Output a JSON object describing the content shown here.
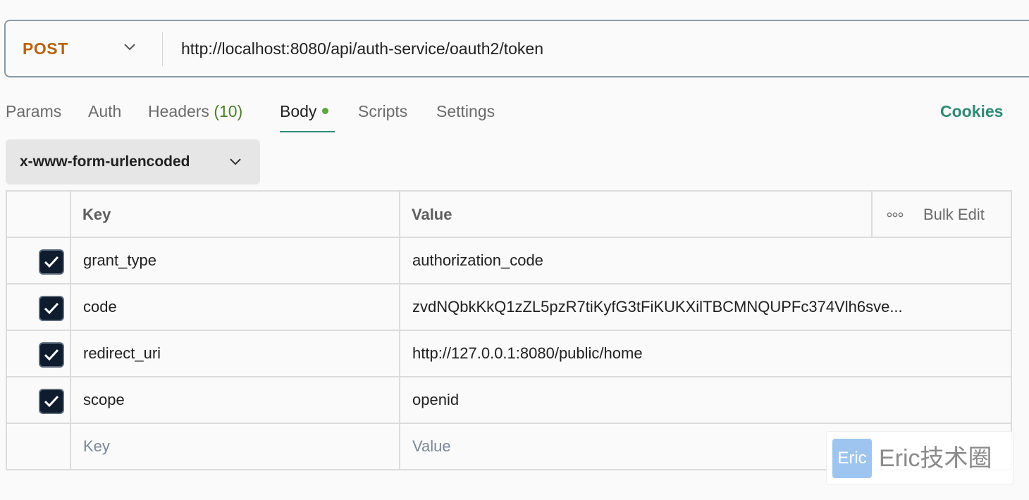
{
  "request": {
    "method": "POST",
    "url": "http://localhost:8080/api/auth-service/oauth2/token"
  },
  "tabs": {
    "params": "Params",
    "auth": "Auth",
    "headers": "Headers",
    "headers_count": "(10)",
    "body": "Body",
    "scripts": "Scripts",
    "settings": "Settings",
    "active": "Body"
  },
  "cookies_label": "Cookies",
  "body_type": "x-www-form-urlencoded",
  "table": {
    "key_header": "Key",
    "value_header": "Value",
    "bulk_edit": "Bulk Edit",
    "rows": [
      {
        "checked": true,
        "key": "grant_type",
        "value": "authorization_code"
      },
      {
        "checked": true,
        "key": "code",
        "value": "zvdNQbkKkQ1zZL5pzR7tiKyfG3tFiKUKXilTBCMNQUPFc374Vlh6sve..."
      },
      {
        "checked": true,
        "key": "redirect_uri",
        "value": "http://127.0.0.1:8080/public/home"
      },
      {
        "checked": true,
        "key": "scope",
        "value": "openid"
      }
    ],
    "key_placeholder": "Key",
    "value_placeholder": "Value"
  },
  "watermark": {
    "logo_text": "Eric",
    "text": "Eric技术圈"
  },
  "colors": {
    "method": "#b8640f",
    "accent": "#2e8a74",
    "count": "#4d7e2b",
    "dot": "#5aa73a",
    "checkbox": "#0e1c2e"
  },
  "icons": [
    "chevron-down-icon",
    "more-horizontal-icon",
    "checkmark-icon"
  ]
}
